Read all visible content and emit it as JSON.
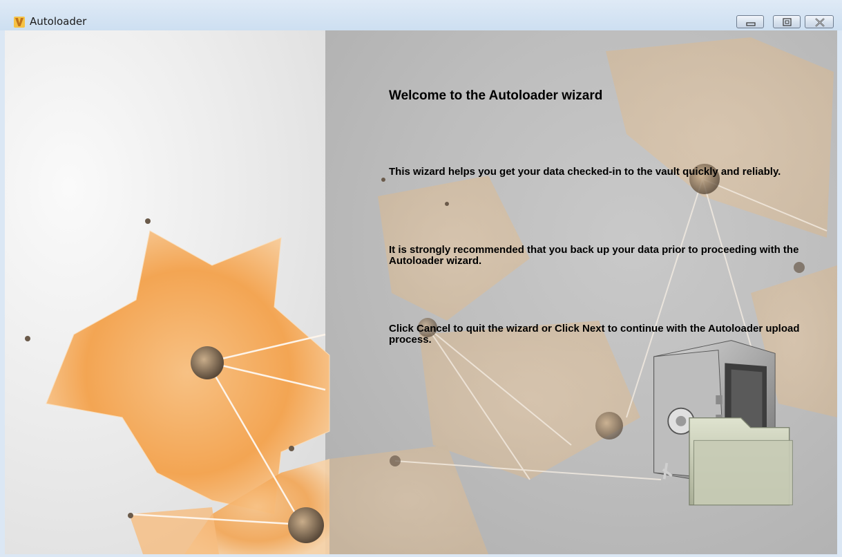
{
  "window": {
    "title": "Autoloader",
    "icon": "autodesk-vault-v-icon",
    "controls": [
      "minimize-icon",
      "maximize-icon",
      "close-icon"
    ]
  },
  "wizard": {
    "heading": "Welcome to the Autoloader wizard",
    "paragraphs": [
      "This wizard helps you get your data checked-in to the vault quickly and reliably.",
      "It is strongly recommended that you back up your data prior to proceeding with the Autoloader wizard.",
      "Click Cancel to quit the wizard or Click Next to continue with the Autoloader upload process."
    ],
    "illustration": "vault-safe-with-folder-icon"
  },
  "colors": {
    "accent_orange": "#f3a553",
    "titlebar": "#d6e4f3"
  }
}
